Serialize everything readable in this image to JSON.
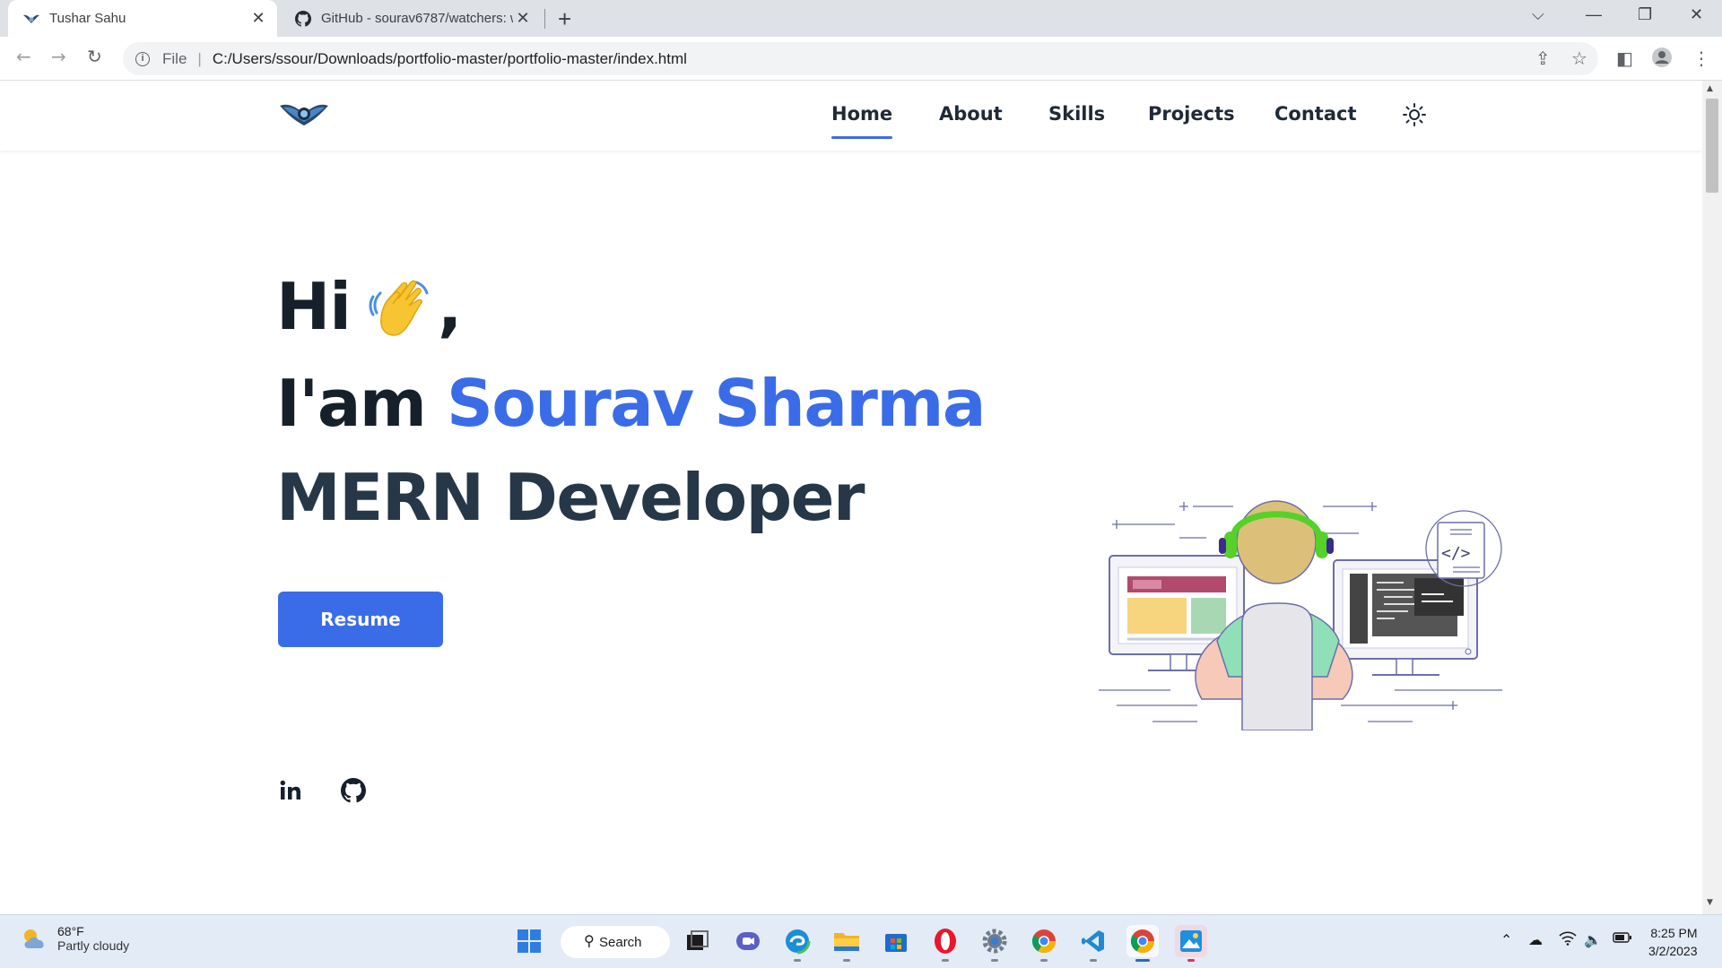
{
  "browser": {
    "tabs": [
      {
        "title": "Tushar Sahu",
        "active": true
      },
      {
        "title": "GitHub - sourav6787/watchers: w",
        "active": false
      }
    ],
    "address": {
      "scheme": "File",
      "url": "C:/Users/ssour/Downloads/portfolio-master/portfolio-master/index.html"
    }
  },
  "site": {
    "nav": [
      {
        "label": "Home",
        "active": true
      },
      {
        "label": "About",
        "active": false
      },
      {
        "label": "Skills",
        "active": false
      },
      {
        "label": "Projects",
        "active": false
      },
      {
        "label": "Contact",
        "active": false
      }
    ],
    "hero": {
      "greeting": "Hi",
      "comma": ",",
      "intro_prefix": "I'am",
      "name": "Sourav Sharma",
      "role": "MERN Developer",
      "resume_label": "Resume"
    },
    "social": [
      "linkedin-icon",
      "github-icon"
    ],
    "colors": {
      "accent": "#3b6ce8",
      "heading": "#16202a"
    }
  },
  "taskbar": {
    "weather": {
      "temp": "68°F",
      "condition": "Partly cloudy"
    },
    "search_label": "Search",
    "clock": {
      "time": "8:25 PM",
      "date": "3/2/2023"
    }
  }
}
